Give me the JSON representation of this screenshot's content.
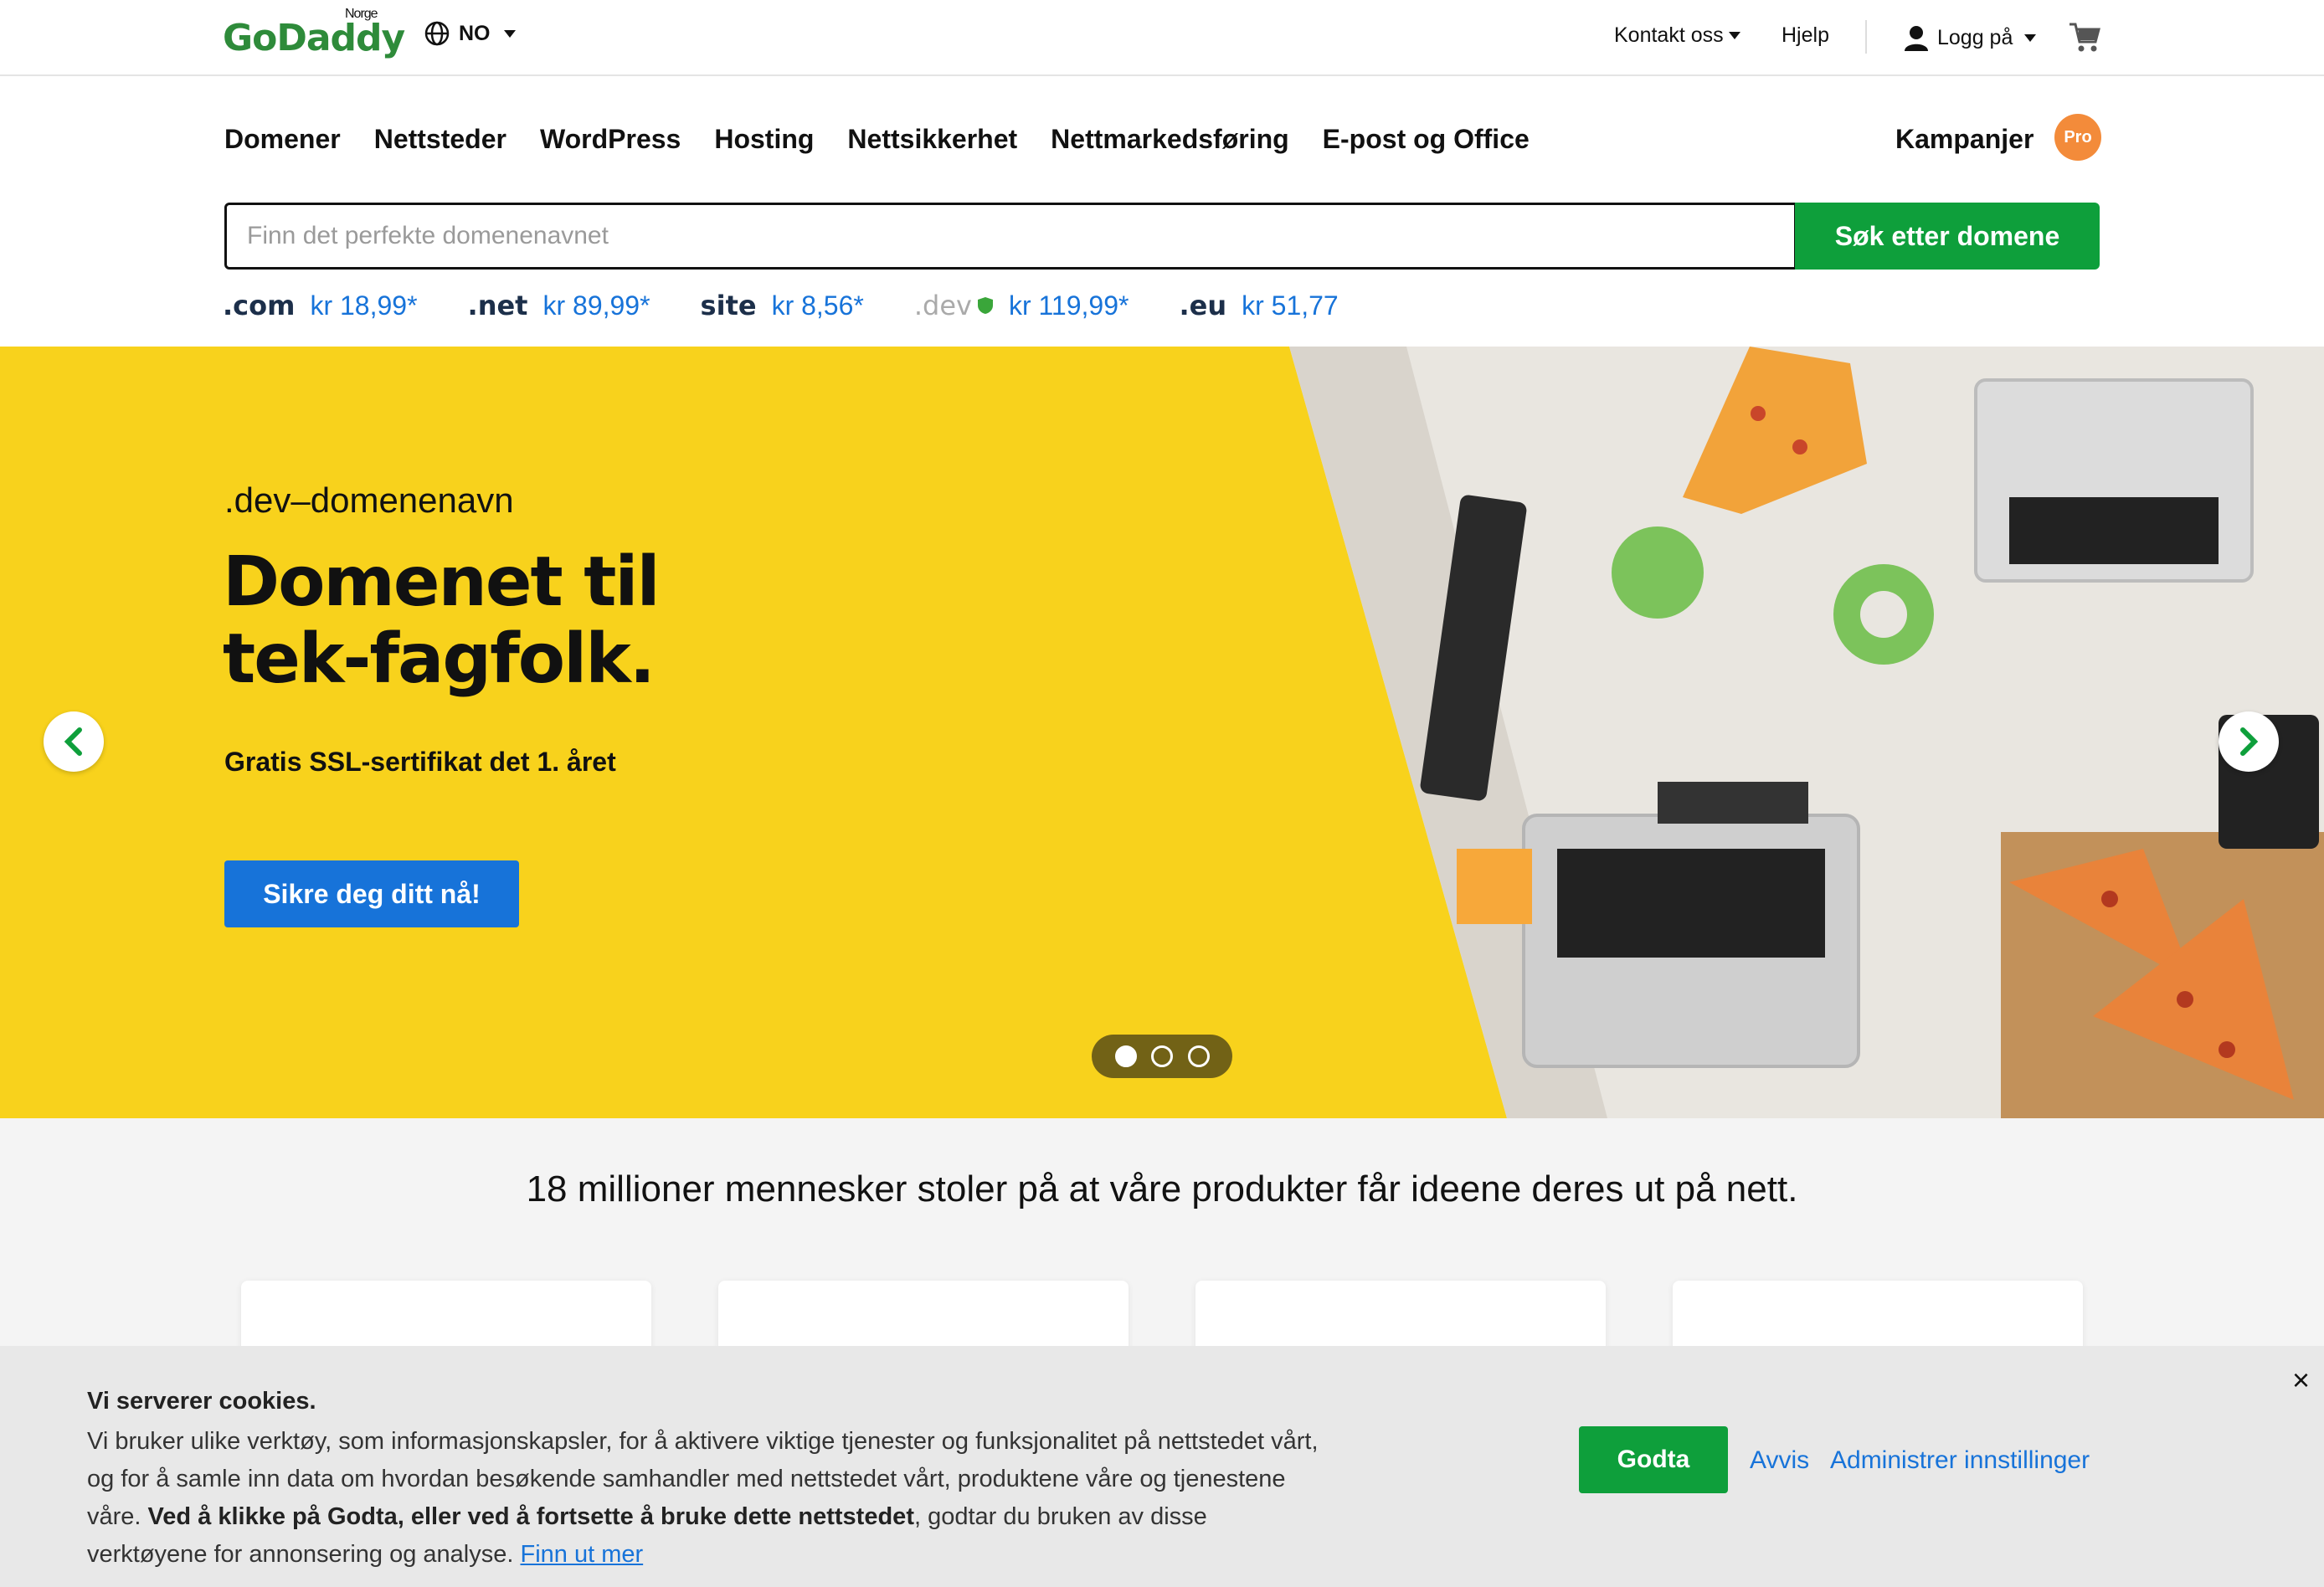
{
  "brand": {
    "name": "GoDaddy",
    "region": "Norge"
  },
  "topbar": {
    "language": "NO",
    "contact": "Kontakt oss",
    "help": "Hjelp",
    "login": "Logg på"
  },
  "nav": {
    "items": [
      "Domener",
      "Nettsteder",
      "WordPress",
      "Hosting",
      "Nettsikkerhet",
      "Nettmarkedsføring",
      "E-post og Office"
    ],
    "promo": "Kampanjer",
    "badge": "Pro"
  },
  "search": {
    "placeholder": "Finn det perfekte domenenavnet",
    "button": "Søk etter domene"
  },
  "tlds": [
    {
      "name": ".com",
      "price": "kr 18,99*"
    },
    {
      "name": ".net",
      "price": "kr 89,99*"
    },
    {
      "name": "site",
      "price": "kr 8,56*"
    },
    {
      "name": ".dev",
      "price": "kr 119,99*"
    },
    {
      "name": ".eu",
      "price": "kr 51,77"
    }
  ],
  "hero": {
    "kicker": ".dev–domenenavn",
    "title": "Domenet til tek-fagfolk.",
    "subtitle": "Gratis SSL-sertifikat det 1. året",
    "cta": "Sikre deg ditt nå!",
    "slides": 3,
    "active_slide": 1
  },
  "trust": {
    "text": "18 millioner mennesker stoler på at våre produkter får ideene deres ut på nett."
  },
  "cookie": {
    "title": "Vi serverer cookies.",
    "body_intro": "Vi bruker ulike verktøy, som informasjonskapsler, for å aktivere viktige tjenester og funksjonalitet på nettstedet vårt, og for å samle inn data om hvordan besøkende samhandler med nettstedet vårt, produktene våre og tjenestene våre.",
    "body_bold": "Ved å klikke på Godta, eller ved å fortsette å bruke dette nettstedet",
    "body_end": ", godtar du bruken av disse verktøyene for annonsering og analyse.",
    "learn_more": "Finn ut mer",
    "accept": "Godta",
    "reject": "Avvis",
    "manage": "Administrer innstillinger",
    "close": "×"
  },
  "colors": {
    "green": "#0e9f3b",
    "blue": "#1773d9",
    "yellow": "#f8d21c",
    "pro": "#f38b3a"
  }
}
